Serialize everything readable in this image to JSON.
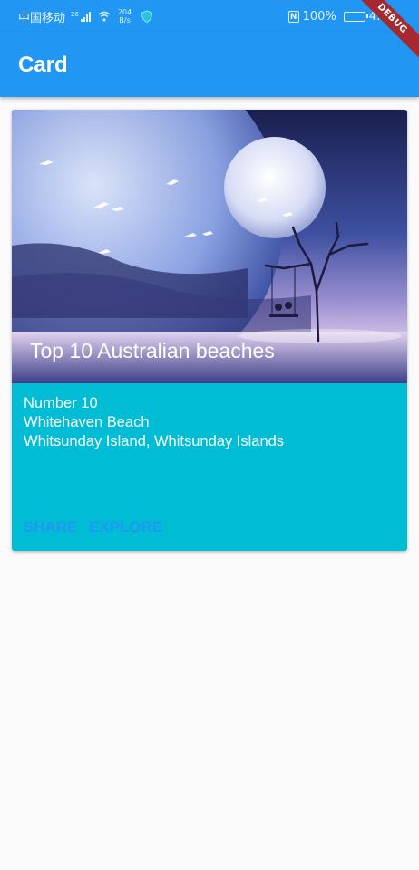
{
  "status_bar": {
    "carrier": "中国移动",
    "network": "26",
    "speed_value": "204",
    "speed_unit": "B/s",
    "battery": "100%",
    "time": "4:29"
  },
  "app_bar": {
    "title": "Card"
  },
  "debug_banner": "DEBUG",
  "card": {
    "image_title": "Top 10 Australian beaches",
    "lines": [
      "Number 10",
      "Whitehaven Beach",
      "Whitsunday Island, Whitsunday Islands"
    ],
    "actions": [
      "SHARE",
      "EXPLORE"
    ]
  },
  "colors": {
    "primary": "#2196f3",
    "card_background": "#00bcd4",
    "page_background": "#fafafa",
    "debug_banner": "#a5292f"
  }
}
